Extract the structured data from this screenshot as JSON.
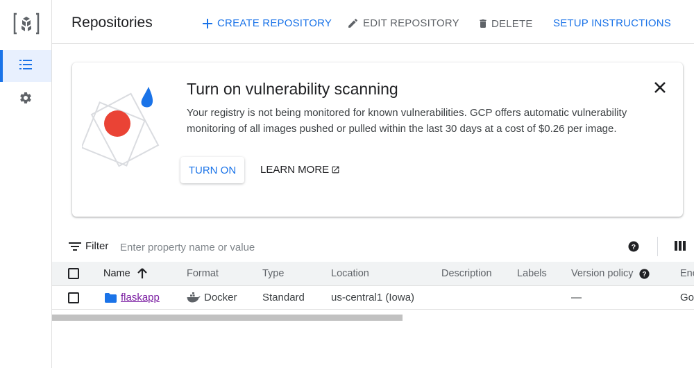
{
  "header": {
    "title": "Repositories",
    "create_label": "CREATE REPOSITORY",
    "edit_label": "EDIT REPOSITORY",
    "delete_label": "DELETE",
    "setup_label": "SETUP INSTRUCTIONS"
  },
  "banner": {
    "title": "Turn on vulnerability scanning",
    "description": "Your registry is not being monitored for known vulnerabilities. GCP offers automatic vulnerability monitoring of all images pushed or pulled within the last 30 days at a cost of $0.26 per image.",
    "turn_on_label": "TURN ON",
    "learn_more_label": "LEARN MORE"
  },
  "filter": {
    "label": "Filter",
    "placeholder": "Enter property name or value"
  },
  "table": {
    "columns": {
      "name": "Name",
      "format": "Format",
      "type": "Type",
      "location": "Location",
      "description": "Description",
      "labels": "Labels",
      "version_policy": "Version policy",
      "encryption": "Enc"
    },
    "rows": [
      {
        "name": "flaskapp",
        "format": "Docker",
        "type": "Standard",
        "location": "us-central1 (Iowa)",
        "description": "",
        "labels": "",
        "version_policy": "—",
        "encryption": "Go"
      }
    ]
  },
  "colors": {
    "accent": "#1a73e8",
    "link_visited": "#7b1fa2",
    "illustration_red": "#ea4335"
  }
}
